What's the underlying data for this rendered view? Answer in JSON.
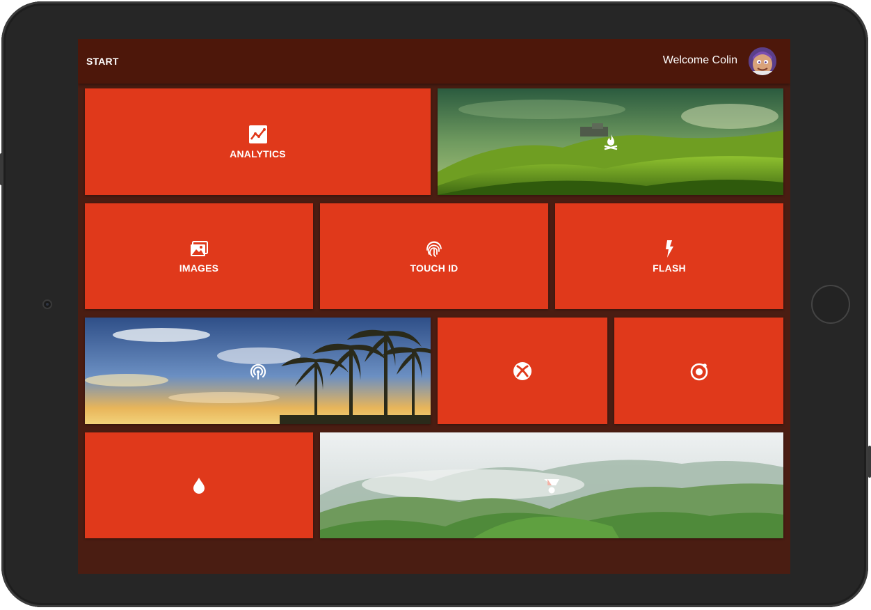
{
  "header": {
    "start_label": "START",
    "welcome_text": "Welcome Colin"
  },
  "theme": {
    "tile_color": "#e0391b",
    "background_color": "#4a1d12",
    "header_color": "#4d170a"
  },
  "tiles": [
    {
      "label": "ANALYTICS",
      "icon": "analytics-icon"
    },
    {
      "label": "",
      "icon": "campfire-icon"
    },
    {
      "label": "IMAGES",
      "icon": "images-icon"
    },
    {
      "label": "TOUCH ID",
      "icon": "fingerprint-icon"
    },
    {
      "label": "FLASH",
      "icon": "flash-icon"
    },
    {
      "label": "",
      "icon": "broadcast-icon"
    },
    {
      "label": "",
      "icon": "xbox-icon"
    },
    {
      "label": "",
      "icon": "ionic-icon"
    },
    {
      "label": "",
      "icon": "water-drop-icon"
    },
    {
      "label": "",
      "icon": "polymer-icon"
    }
  ]
}
